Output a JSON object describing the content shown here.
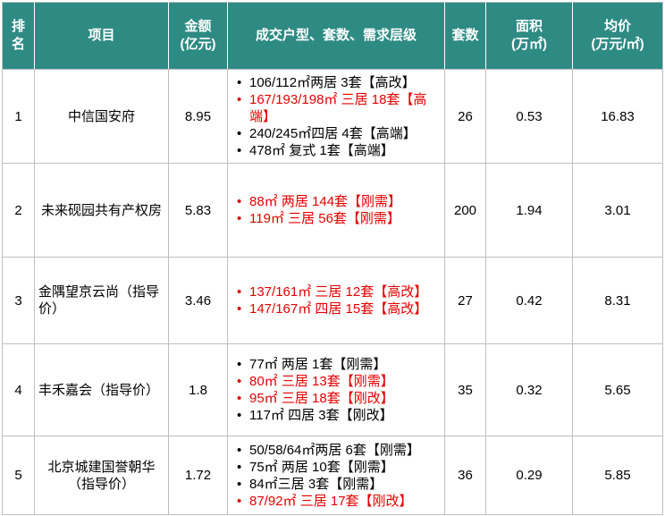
{
  "colors": {
    "header_bg": "#2e8b84",
    "highlight": "#e60000",
    "text": "#000000"
  },
  "header": {
    "rank": "排名",
    "project": "项目",
    "amount": "金额\n(亿元)",
    "detail": "成交户型、套数、需求层级",
    "units": "套数",
    "area": "面积\n(万㎡)",
    "avg_price": "均价\n(万元/㎡)"
  },
  "rows": [
    {
      "rank": "1",
      "project": "中信国安府",
      "amount": "8.95",
      "details": [
        {
          "text": "106/112㎡两居 3套【高改】",
          "highlight": false
        },
        {
          "text": "167/193/198㎡ 三居 18套【高端】",
          "highlight": true
        },
        {
          "text": "240/245㎡四居 4套【高端】",
          "highlight": false
        },
        {
          "text": "478㎡ 复式 1套【高端】",
          "highlight": false
        }
      ],
      "units": "26",
      "area": "0.53",
      "avg_price": "16.83"
    },
    {
      "rank": "2",
      "project": "未来砚园共有产权房",
      "amount": "5.83",
      "details": [
        {
          "text": "88㎡ 两居 144套【刚需】",
          "highlight": true
        },
        {
          "text": "119㎡ 三居 56套【刚需】",
          "highlight": true
        }
      ],
      "units": "200",
      "area": "1.94",
      "avg_price": "3.01"
    },
    {
      "rank": "3",
      "project": "金隅望京云尚（指导价）",
      "amount": "3.46",
      "details": [
        {
          "text": "137/161㎡ 三居 12套【高改】",
          "highlight": true
        },
        {
          "text": "147/167㎡ 四居 15套【高改】",
          "highlight": true
        }
      ],
      "units": "27",
      "area": "0.42",
      "avg_price": "8.31"
    },
    {
      "rank": "4",
      "project": "丰禾嘉会（指导价）",
      "amount": "1.8",
      "details": [
        {
          "text": "77㎡ 两居 1套【刚需】",
          "highlight": false
        },
        {
          "text": "80㎡ 三居 13套【刚需】",
          "highlight": true
        },
        {
          "text": "95㎡ 三居 18套【刚改】",
          "highlight": true
        },
        {
          "text": "117㎡ 四居 3套【刚改】",
          "highlight": false
        }
      ],
      "units": "35",
      "area": "0.32",
      "avg_price": "5.65"
    },
    {
      "rank": "5",
      "project": "北京城建国誉朝华（指导价）",
      "amount": "1.72",
      "details": [
        {
          "text": "50/58/64㎡两居 6套【刚需】",
          "highlight": false
        },
        {
          "text": "75㎡ 两居 10套【刚需】",
          "highlight": false
        },
        {
          "text": "84㎡三居 3套【刚需】",
          "highlight": false
        },
        {
          "text": "87/92㎡ 三居 17套【刚改】",
          "highlight": true
        }
      ],
      "units": "36",
      "area": "0.29",
      "avg_price": "5.85"
    }
  ]
}
